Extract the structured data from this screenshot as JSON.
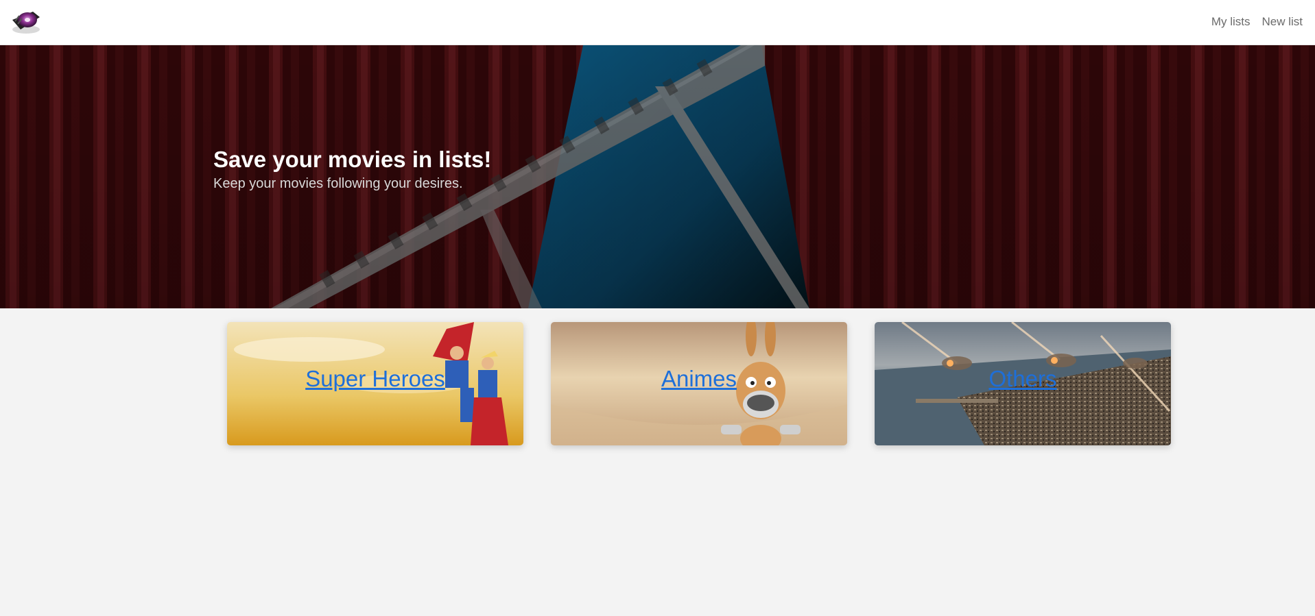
{
  "navbar": {
    "logo_icon": "film-reel-logo-icon",
    "links": [
      {
        "label": "My lists"
      },
      {
        "label": "New list"
      }
    ]
  },
  "hero": {
    "title": "Save your movies in lists!",
    "subtitle": "Keep your movies following your desires.",
    "background": "theater-curtain-film-strip-image"
  },
  "categories": [
    {
      "label": "Super Heroes",
      "image": "superheroes-image"
    },
    {
      "label": "Animes",
      "image": "cartoon-donkey-image"
    },
    {
      "label": "Others",
      "image": "city-attack-image"
    }
  ],
  "colors": {
    "link": "#1e6fd9",
    "page_background": "#f3f3f3",
    "curtain": "#5a1014"
  }
}
